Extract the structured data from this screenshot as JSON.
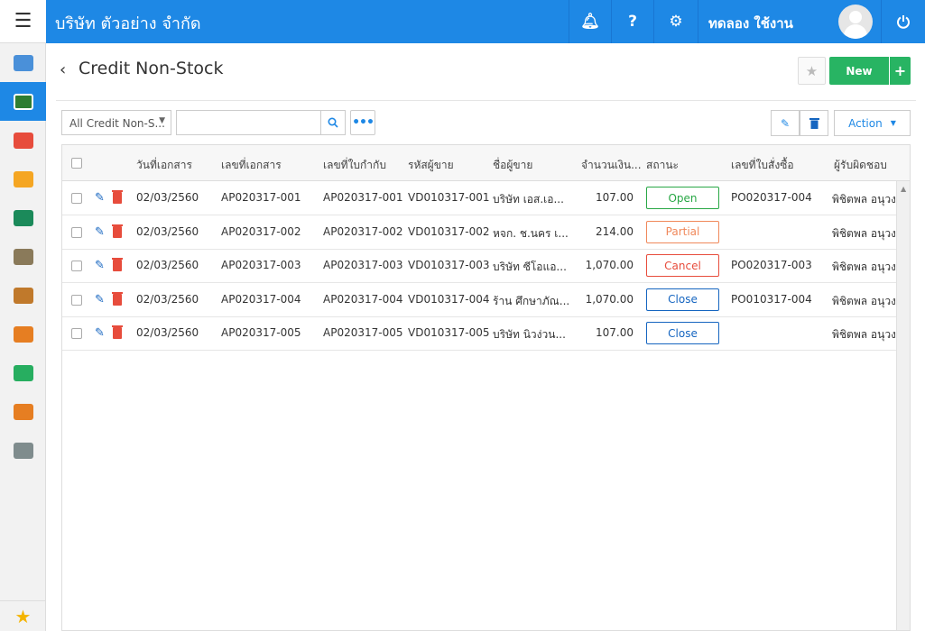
{
  "topbar": {
    "menu_icon": "menu-icon",
    "company": "บริษัท ตัวอย่าง จำกัด",
    "bell_icon": "bell-icon",
    "help_label": "?",
    "gear_icon": "gear-icon",
    "user_name": "ทดลอง ใช้งาน",
    "power_icon": "power-icon",
    "color": "#1e88e5"
  },
  "sidebar": {
    "items": [
      {
        "icon": "dashboard-icon",
        "color": "#4a90d9"
      },
      {
        "icon": "money-icon",
        "color": "#2e7d32",
        "active": true
      },
      {
        "icon": "cart-icon",
        "color": "#e74c3c"
      },
      {
        "icon": "box-icon",
        "color": "#f5a623"
      },
      {
        "icon": "book-icon",
        "color": "#1b8a5a"
      },
      {
        "icon": "bank-icon",
        "color": "#8a7a5a"
      },
      {
        "icon": "wallet-icon",
        "color": "#c0792b"
      },
      {
        "icon": "people-icon",
        "color": "#e67e22"
      },
      {
        "icon": "check-circle-icon",
        "color": "#27ae60"
      },
      {
        "icon": "report-icon",
        "color": "#e67e22"
      },
      {
        "icon": "tools-icon",
        "color": "#7f8c8d"
      }
    ],
    "favorite_icon": "star-icon"
  },
  "page": {
    "back_icon": "chevron-left-icon",
    "title": "Credit Non-Stock",
    "new_label": "New",
    "plus_label": "+"
  },
  "toolbar": {
    "filter_value": "All Credit Non-S...",
    "search_placeholder": "",
    "more_label": "•••",
    "action_label": "Action"
  },
  "table": {
    "headers": [
      "วันที่เอกสาร",
      "เลขที่เอกสาร",
      "เลขที่ใบกำกับ",
      "รหัสผู้ขาย",
      "ชื่อผู้ขาย",
      "จำนวนเงิน...",
      "สถานะ",
      "เลขที่ใบสั่งซื้อ",
      "ผู้รับผิดชอบ"
    ],
    "rows": [
      {
        "date": "02/03/2560",
        "doc": "AP020317-001",
        "invoice": "AP020317-001",
        "vendor_code": "VD010317-001",
        "vendor_name": "บริษัท เอส.เอ...",
        "amount": "107.00",
        "status": "Open",
        "po": "PO020317-004",
        "owner": "พิชิตพล อนุวง"
      },
      {
        "date": "02/03/2560",
        "doc": "AP020317-002",
        "invoice": "AP020317-002",
        "vendor_code": "VD010317-002",
        "vendor_name": "หจก. ช.นคร เ...",
        "amount": "214.00",
        "status": "Partial",
        "po": "",
        "owner": "พิชิตพล อนุวง"
      },
      {
        "date": "02/03/2560",
        "doc": "AP020317-003",
        "invoice": "AP020317-003",
        "vendor_code": "VD010317-003",
        "vendor_name": "บริษัท ซีโอแอ...",
        "amount": "1,070.00",
        "status": "Cancel",
        "po": "PO020317-003",
        "owner": "พิชิตพล อนุวง"
      },
      {
        "date": "02/03/2560",
        "doc": "AP020317-004",
        "invoice": "AP020317-004",
        "vendor_code": "VD010317-004",
        "vendor_name": "ร้าน ศึกษาภัณ...",
        "amount": "1,070.00",
        "status": "Close",
        "po": "PO010317-004",
        "owner": "พิชิตพล อนุวง"
      },
      {
        "date": "02/03/2560",
        "doc": "AP020317-005",
        "invoice": "AP020317-005",
        "vendor_code": "VD010317-005",
        "vendor_name": "บริษัท นิวง่วน...",
        "amount": "107.00",
        "status": "Close",
        "po": "",
        "owner": "พิชิตพล อนุวง"
      }
    ],
    "status_colors": {
      "Open": "#28a745",
      "Partial": "#f0885a",
      "Cancel": "#e74c3c",
      "Close": "#1565c0"
    }
  }
}
